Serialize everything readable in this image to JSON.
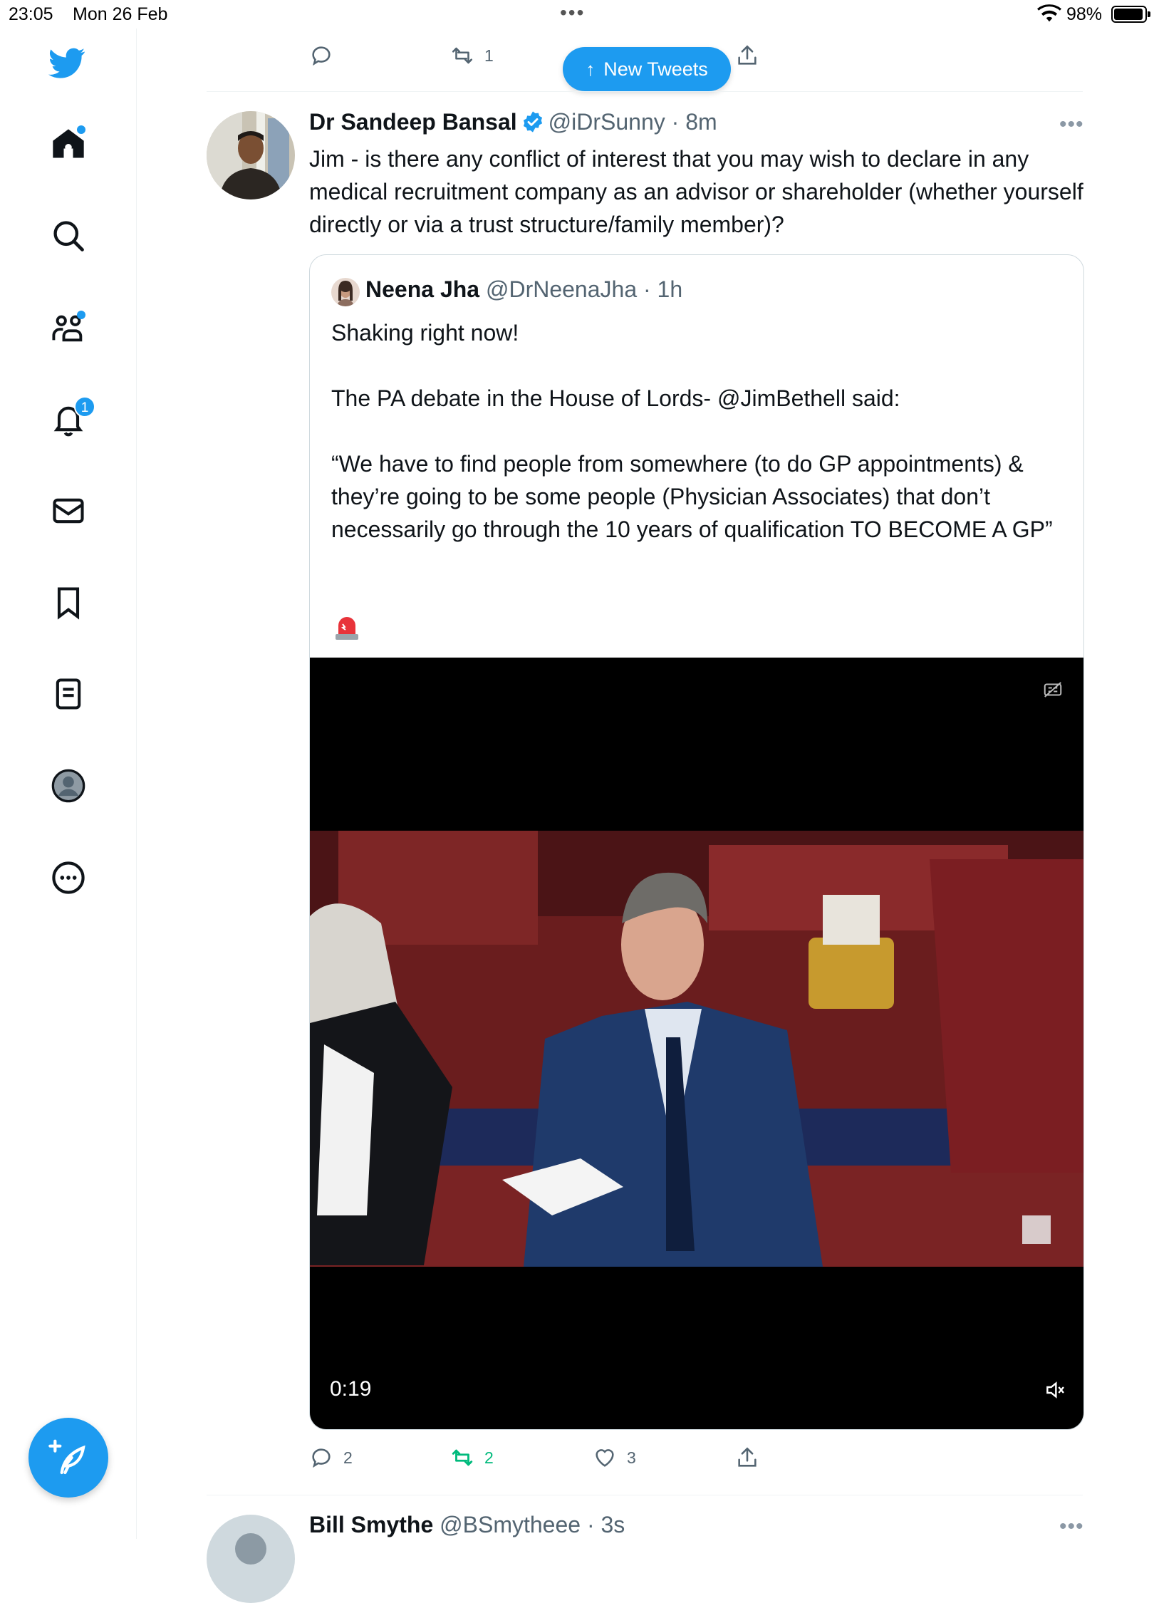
{
  "status_bar": {
    "time": "23:05",
    "date": "Mon 26 Feb",
    "dots": "•••",
    "battery": "98%"
  },
  "sidebar": {
    "items": [
      {
        "name": "twitter-logo-icon"
      },
      {
        "name": "home-icon",
        "has_dot": true
      },
      {
        "name": "search-icon"
      },
      {
        "name": "communities-icon",
        "has_dot": true
      },
      {
        "name": "notifications-icon",
        "badge": "1"
      },
      {
        "name": "messages-icon"
      },
      {
        "name": "bookmarks-icon"
      },
      {
        "name": "lists-icon"
      },
      {
        "name": "profile-icon"
      },
      {
        "name": "more-icon"
      }
    ],
    "compose": "compose-tweet-icon"
  },
  "new_tweets_label": "New Tweets",
  "previous_tweet": {
    "retweets": "1"
  },
  "tweet": {
    "name": "Dr Sandeep Bansal",
    "handle": "@iDrSunny",
    "time": "· 8m",
    "more": "•••",
    "text": "Jim - is there any conflict of interest that you may wish to declare in any medical recruitment company as an advisor or shareholder (whether yourself directly or via a trust structure/family member)?",
    "quote": {
      "name": "Neena Jha",
      "handle": "@DrNeenaJha",
      "time": "· 1h",
      "text": "Shaking right now!\n\nThe PA debate in the House of Lords- @JimBethell said:\n\n“We have to find people from somewhere (to do GP appointments) & they’re going to be some people (Physician Associates) that don’t necessarily go through the 10 years of qualification TO BECOME A GP”",
      "video_time": "0:19"
    },
    "replies": "2",
    "retweets": "2",
    "likes": "3"
  },
  "next_tweet": {
    "name": "Bill Smythe",
    "handle": "@BSmytheee",
    "time": "· 3s",
    "more": "•••"
  },
  "colors": {
    "accent": "#1d9bf0",
    "retweet_active": "#00ba7c",
    "secondary_text": "#536471"
  }
}
